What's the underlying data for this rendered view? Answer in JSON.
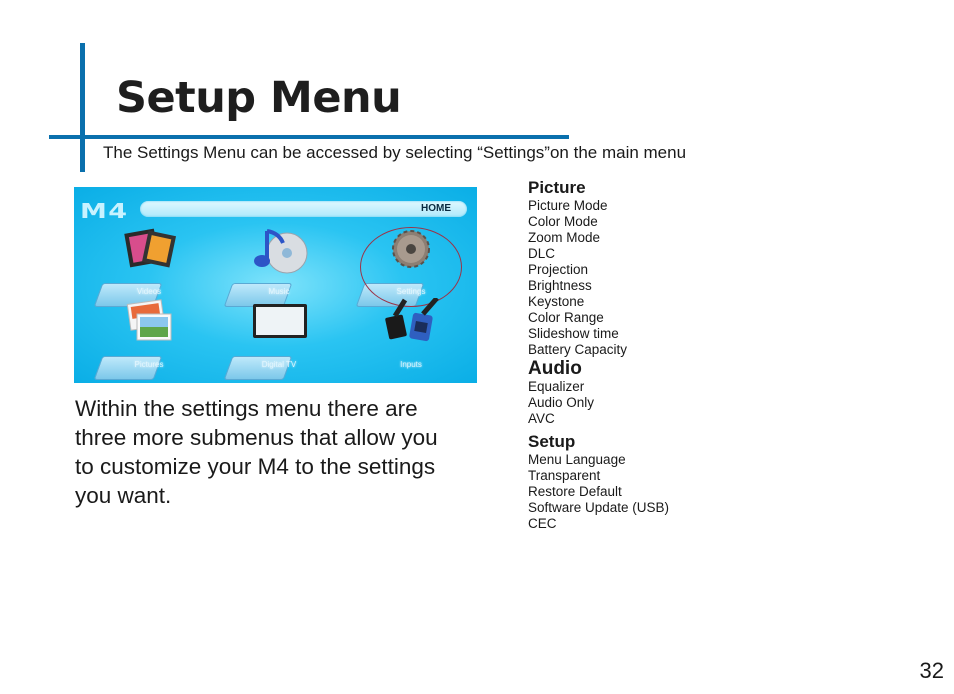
{
  "header": {
    "title": "Setup Menu",
    "subtitle": "The Settings Menu can be accessed by selecting “Settings”on the main menu",
    "accent_color": "#0a70ad"
  },
  "device_screen": {
    "logo": "M4",
    "home_label": "HOME",
    "selected_tile": "Settings",
    "selection_ring_color": "#9c3347",
    "tiles": [
      {
        "label": "Videos",
        "icon": "film-photos-icon"
      },
      {
        "label": "Music",
        "icon": "music-disc-icon"
      },
      {
        "label": "Settings",
        "icon": "gear-icon"
      },
      {
        "label": "Pictures",
        "icon": "photos-icon"
      },
      {
        "label": "Digital TV",
        "icon": "tv-icon"
      },
      {
        "label": "Inputs",
        "icon": "cables-icon"
      }
    ]
  },
  "body": {
    "lines": [
      "Within the settings menu there are",
      "three  more submenus that allow you",
      "to customize your M4 to the settings",
      "you want."
    ]
  },
  "menu": {
    "groups": [
      {
        "heading": "Picture",
        "items": [
          "Picture Mode",
          "Color Mode",
          "Zoom Mode",
          "DLC",
          "Projection",
          "Brightness",
          "Keystone",
          "Color Range",
          "Slideshow time",
          "Battery Capacity"
        ]
      },
      {
        "heading": "Audio",
        "items": [
          "Equalizer",
          "Audio Only",
          "AVC"
        ]
      },
      {
        "heading": "Setup",
        "items": [
          "Menu Language",
          "Transparent",
          "Restore Default",
          "Software Update (USB)",
          "CEC"
        ]
      }
    ]
  },
  "footer": {
    "page_number": "32"
  }
}
